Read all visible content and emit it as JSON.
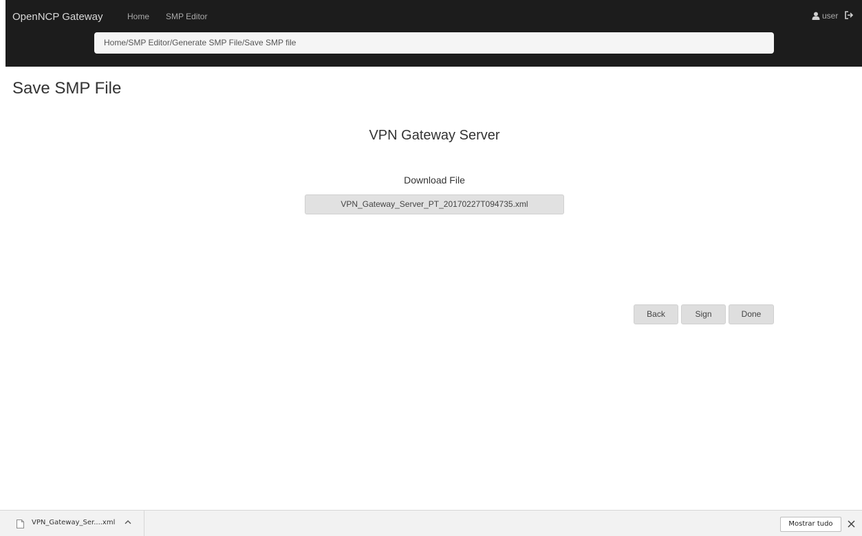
{
  "header": {
    "brand": "OpenNCP Gateway",
    "nav": {
      "home": "Home",
      "smp_editor": "SMP Editor"
    },
    "user_label": "user",
    "user_icon": "user-icon",
    "logout_icon": "logout-icon"
  },
  "breadcrumb": "Home/SMP Editor/Generate SMP File/Save SMP file",
  "page": {
    "title": "Save SMP File",
    "subtitle": "VPN Gateway Server",
    "download_label": "Download File",
    "file_name": "VPN_Gateway_Server_PT_20170227T094735.xml"
  },
  "actions": {
    "back": "Back",
    "sign": "Sign",
    "done": "Done"
  },
  "download_bar": {
    "file_label": "VPN_Gateway_Ser....xml",
    "show_all": "Mostrar tudo",
    "file_icon": "file-icon",
    "chevron_icon": "chevron-up-icon",
    "close_icon": "close-icon"
  },
  "colors": {
    "navbar_bg": "#1c1c1c",
    "breadcrumb_bg": "#f5f5f5",
    "button_bg": "#dedede"
  }
}
